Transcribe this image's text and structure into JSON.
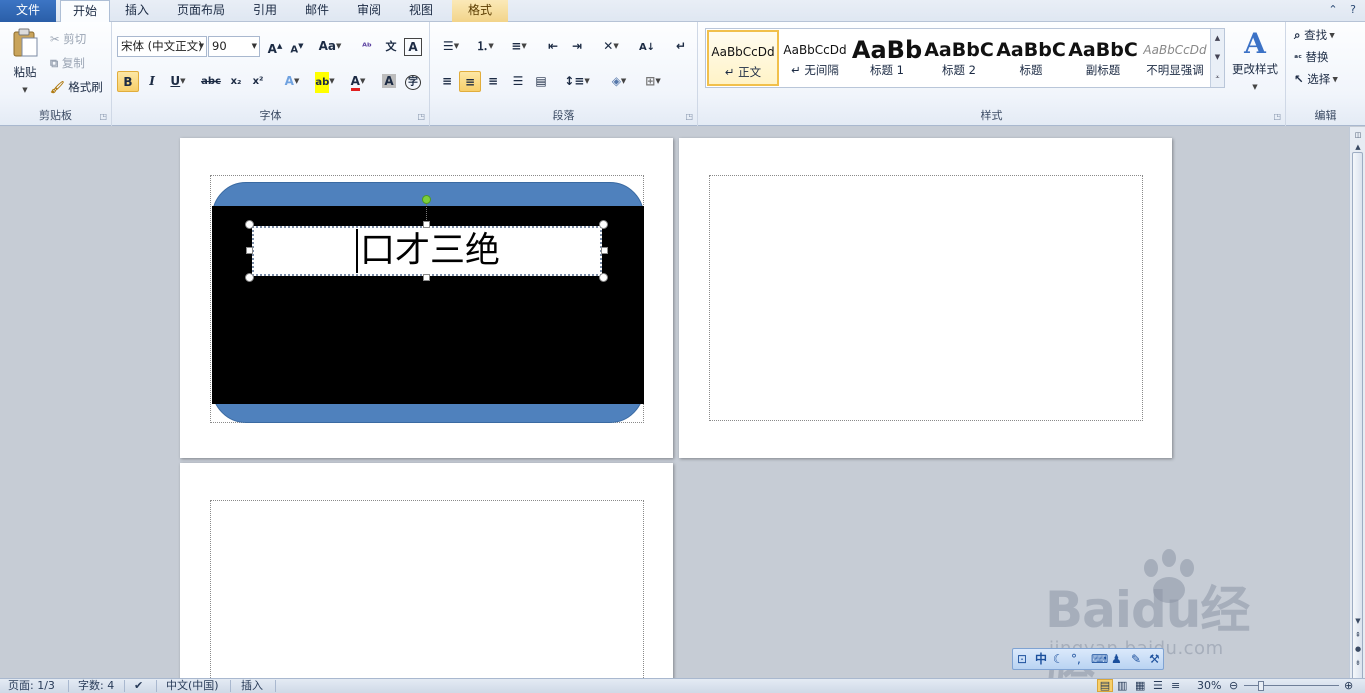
{
  "tabs": [
    {
      "label": "文件",
      "key": "file"
    },
    {
      "label": "开始",
      "key": "home",
      "active": true
    },
    {
      "label": "插入",
      "key": "insert"
    },
    {
      "label": "页面布局",
      "key": "layout"
    },
    {
      "label": "引用",
      "key": "references"
    },
    {
      "label": "邮件",
      "key": "mailings"
    },
    {
      "label": "审阅",
      "key": "review"
    },
    {
      "label": "视图",
      "key": "view"
    },
    {
      "label": "格式",
      "key": "format",
      "contextual": true
    }
  ],
  "clipboard": {
    "group": "剪贴板",
    "paste": "粘贴",
    "cut": "剪切",
    "copy": "复制",
    "format_painter": "格式刷"
  },
  "font": {
    "group": "字体",
    "font_name": "宋体 (中文正文)",
    "font_size": "90"
  },
  "paragraph": {
    "group": "段落"
  },
  "styles": {
    "group": "样式",
    "items": [
      {
        "sample": "AaBbCcDd",
        "name": "↵ 正文",
        "selected": true
      },
      {
        "sample": "AaBbCcDd",
        "name": "↵ 无间隔"
      },
      {
        "sample": "AaBb",
        "name": "标题 1"
      },
      {
        "sample": "AaBbC",
        "name": "标题 2"
      },
      {
        "sample": "AaBbC",
        "name": "标题"
      },
      {
        "sample": "AaBbC",
        "name": "副标题"
      },
      {
        "sample": "AaBbCcDd",
        "name": "不明显强调"
      }
    ],
    "change_styles": "更改样式"
  },
  "editing": {
    "group": "编辑",
    "find": "查找",
    "replace": "替换",
    "select": "选择"
  },
  "document": {
    "textbox_text": "口才三绝"
  },
  "ime_bar": {
    "lang": "中"
  },
  "watermark": {
    "brand": "Baidu经验",
    "url": "jingyan.baidu.com"
  },
  "status_bar": {
    "page": "页面: 1/3",
    "words": "字数: 4",
    "language": "中文(中国)",
    "mode": "插入",
    "zoom": "30%"
  },
  "colors": {
    "accent_blue": "#4f81bd",
    "file_tab": "#2a5ea8",
    "selection_yellow": "#f7cf6a",
    "rotation_handle": "#7ccf3a"
  }
}
